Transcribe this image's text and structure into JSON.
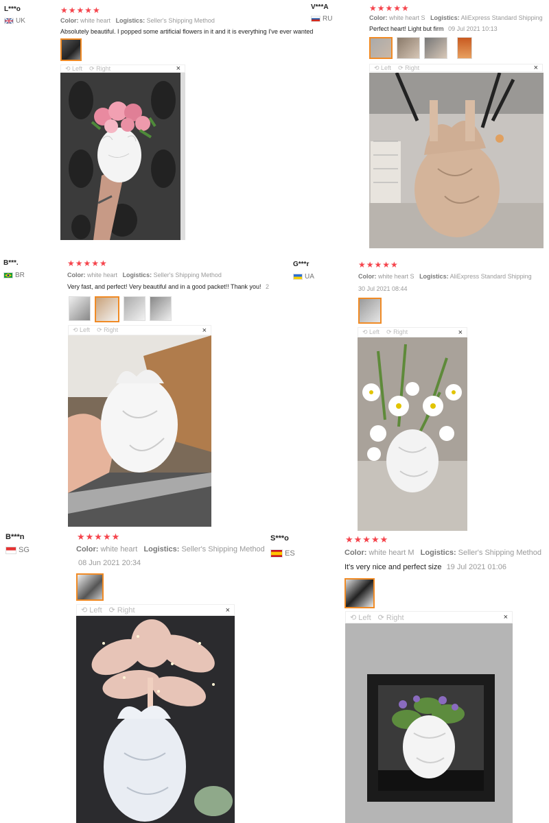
{
  "reviews": [
    {
      "user": "L***o",
      "country": "UK",
      "stars": "★★★★★",
      "color_label": "Color:",
      "color": "white heart",
      "logistics_label": "Logistics:",
      "logistics": "Seller's Shipping Method",
      "text": "Absolutely beautiful. I popped some artificial flowers in it and it is everything I've ever wanted",
      "date": "",
      "viewer": {
        "left": "Left",
        "right": "Right",
        "close": "×"
      }
    },
    {
      "user": "V***A",
      "country": "RU",
      "stars": "★★★★★",
      "color_label": "Color:",
      "color": "white heart S",
      "logistics_label": "Logistics:",
      "logistics": "AliExpress Standard Shipping",
      "text": "Perfect heart! Light but firm",
      "date": "09 Jul 2021 10:13",
      "viewer": {
        "left": "Left",
        "right": "Right",
        "close": "×"
      }
    },
    {
      "user": "B***.",
      "country": "BR",
      "stars": "★★★★★",
      "color_label": "Color:",
      "color": "white heart",
      "logistics_label": "Logistics:",
      "logistics": "Seller's Shipping Method",
      "text": "Very fast, and perfect! Very beautiful and in a good packet!! Thank you!",
      "date": "2",
      "viewer": {
        "left": "Left",
        "right": "Right",
        "close": "×"
      }
    },
    {
      "user": "G***r",
      "country": "UA",
      "stars": "★★★★★",
      "color_label": "Color:",
      "color": "white heart S",
      "logistics_label": "Logistics:",
      "logistics": "AliExpress Standard Shipping",
      "text": "",
      "date": "30 Jul 2021 08:44",
      "viewer": {
        "left": "Left",
        "right": "Right",
        "close": "×"
      }
    },
    {
      "user": "B***n",
      "country": "SG",
      "stars": "★★★★★",
      "color_label": "Color:",
      "color": "white heart",
      "logistics_label": "Logistics:",
      "logistics": "Seller's Shipping Method",
      "text": "",
      "date": "08 Jun 2021 20:34",
      "viewer": {
        "left": "Left",
        "right": "Right",
        "close": "×"
      }
    },
    {
      "user": "S***o",
      "country": "ES",
      "stars": "★★★★★",
      "color_label": "Color:",
      "color": "white heart M",
      "logistics_label": "Logistics:",
      "logistics": "Seller's Shipping Method",
      "text": "It's very nice and perfect size",
      "date": "19 Jul 2021 01:06",
      "viewer": {
        "left": "Left",
        "right": "Right",
        "close": "×"
      }
    }
  ],
  "colors": {
    "star": "#f5444c",
    "thumb_active": "#f08a24"
  }
}
